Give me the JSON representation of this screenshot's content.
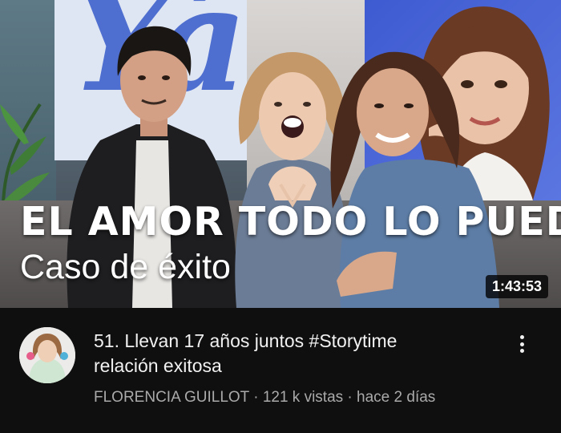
{
  "thumbnail": {
    "logo_text": "Yá",
    "title_line1": "EL AMOR TODO LO PUEDE",
    "title_line2": "Caso de éxito",
    "duration": "1:43:53"
  },
  "video": {
    "title_line1": "51. Llevan 17 años juntos #Storytime",
    "title_line2": "relación exitosa",
    "channel": "FLORENCIA GUILLOT",
    "separator": " · ",
    "views": "121 k vistas",
    "age": "hace 2 días"
  },
  "icons": {
    "more": "more-vert-icon"
  },
  "colors": {
    "background": "#0f0f0f",
    "text_primary": "#f1f1f1",
    "text_secondary": "#aaaaaa",
    "logo_blue": "#4f6fd0",
    "portrait_blue": "#3e5bd1"
  }
}
